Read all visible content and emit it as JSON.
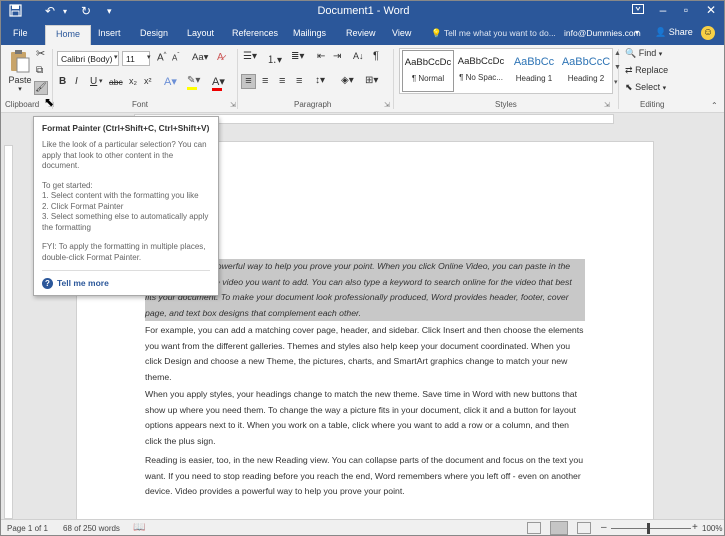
{
  "title_bar": {
    "doc_title": "Document1 - Word"
  },
  "tabs": [
    "File",
    "Home",
    "Insert",
    "Design",
    "Layout",
    "References",
    "Mailings",
    "Review",
    "View"
  ],
  "tell_me": {
    "placeholder": "Tell me what you want to do..."
  },
  "account": "info@Dummies.com",
  "share_label": "Share",
  "clipboard": {
    "paste": "Paste",
    "label": "Clipboard"
  },
  "font": {
    "name": "Calibri (Body)",
    "size": "11",
    "label": "Font"
  },
  "paragraph": {
    "label": "Paragraph"
  },
  "styles": {
    "label": "Styles",
    "items": [
      {
        "sample": "AaBbCcDc",
        "name": "¶ Normal"
      },
      {
        "sample": "AaBbCcDc",
        "name": "¶ No Spac..."
      },
      {
        "sample": "AaBbCc",
        "name": "Heading 1"
      },
      {
        "sample": "AaBbCcC",
        "name": "Heading 2"
      }
    ]
  },
  "editing": {
    "find": "Find",
    "replace": "Replace",
    "select": "Select",
    "label": "Editing"
  },
  "tooltip": {
    "title": "Format Painter (Ctrl+Shift+C, Ctrl+Shift+V)",
    "intro": "Like the look of a particular selection? You can apply that look to other content in the document.",
    "steps_heading": "To get started:",
    "step1": "1. Select content with the formatting you like",
    "step2": "2. Click Format Painter",
    "step3": "3. Select something else to automatically apply the formatting",
    "fyi": "FYI: To apply the formatting in multiple places, double-click Format Painter.",
    "more": "Tell me more"
  },
  "document": {
    "p1": "Video provides a powerful way to help you prove your point. When you click Online Video, you can paste in the embed code for the video you want to add. You can also type a keyword to search online for the video that best fits your document. To make your document look professionally produced, Word provides header, footer, cover page, and text box designs that complement each other.",
    "p2": "For example, you can add a matching cover page, header, and sidebar. Click Insert and then choose the elements you want from the different galleries. Themes and styles also help keep your document coordinated. When you click Design and choose a new Theme, the pictures, charts, and SmartArt graphics change to match your new theme.",
    "p3": "When you apply styles, your headings change to match the new theme. Save time in Word with new buttons that show up where you need them. To change the way a picture fits in your document, click it and a button for layout options appears next to it. When you work on a table, click where you want to add a row or a column, and then click the plus sign.",
    "p4": "Reading is easier, too, in the new Reading view. You can collapse parts of the document and focus on the text you want. If you need to stop reading before you reach the end, Word remembers where you left off - even on another device. Video provides a powerful way to help you prove your point."
  },
  "status": {
    "page": "Page 1 of 1",
    "words": "68 of 250 words",
    "zoom": "100%"
  },
  "colors": {
    "accent": "#2b579a",
    "selection": "#c8c8c8"
  }
}
